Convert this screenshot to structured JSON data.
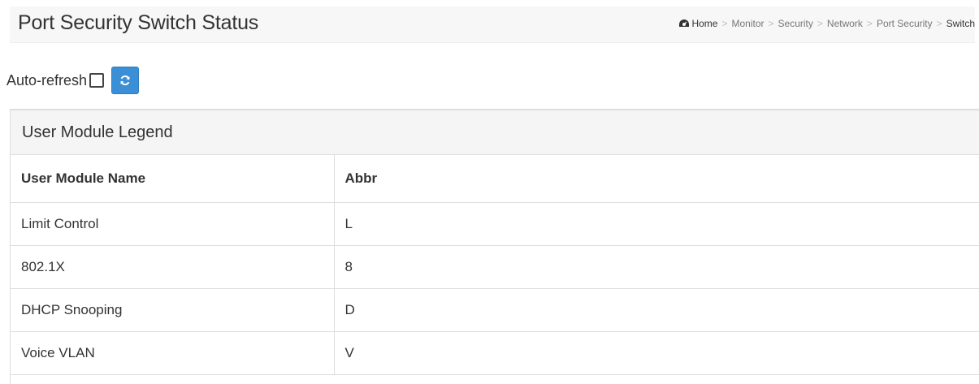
{
  "header": {
    "title": "Port Security Switch Status",
    "breadcrumb": [
      "Home",
      "Monitor",
      "Security",
      "Network",
      "Port Security",
      "Switch"
    ],
    "separator": ">"
  },
  "refresh": {
    "label": "Auto-refresh",
    "checked": false,
    "button_icon": "refresh-icon",
    "button_color": "#3a8fd6"
  },
  "legend": {
    "heading": "User Module Legend",
    "columns": [
      "User Module Name",
      "Abbr"
    ],
    "rows": [
      {
        "name": "Limit Control",
        "abbr": "L"
      },
      {
        "name": "802.1X",
        "abbr": "8"
      },
      {
        "name": "DHCP Snooping",
        "abbr": "D"
      },
      {
        "name": "Voice VLAN",
        "abbr": "V"
      }
    ]
  }
}
